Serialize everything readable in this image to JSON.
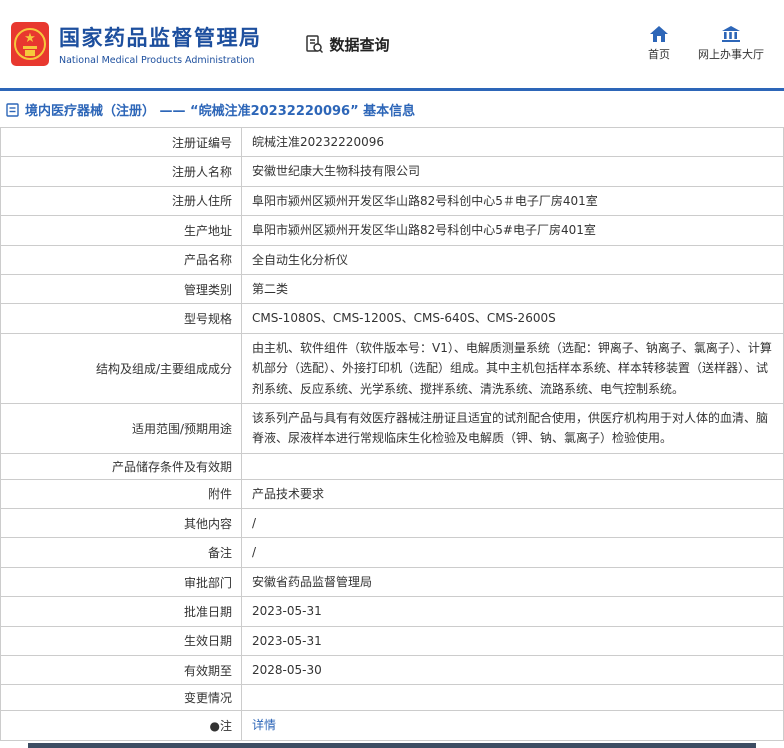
{
  "header": {
    "org_name_cn": "国家药品监督管理局",
    "org_name_en": "National Medical Products Administration",
    "data_query": "数据查询",
    "nav": [
      {
        "label": "首页",
        "icon": "home-icon"
      },
      {
        "label": "网上办事大厅",
        "icon": "building-icon"
      }
    ]
  },
  "page_title": "境内医疗器械（注册） —— “皖械注准20232220096” 基本信息",
  "colors": {
    "accent_blue": "#2d66b8",
    "brand_blue": "#1d4f9e",
    "emblem_red": "#e8382f",
    "emblem_gold": "#f6c83c",
    "table_border": "#cccccc"
  },
  "table": {
    "rows": [
      {
        "label": "注册证编号",
        "value": "皖械注准20232220096"
      },
      {
        "label": "注册人名称",
        "value": "安徽世纪康大生物科技有限公司"
      },
      {
        "label": "注册人住所",
        "value": "阜阳市颍州区颍州开发区华山路82号科创中心5＃电子厂房401室"
      },
      {
        "label": "生产地址",
        "value": "阜阳市颍州区颍州开发区华山路82号科创中心5#电子厂房401室"
      },
      {
        "label": "产品名称",
        "value": "全自动生化分析仪"
      },
      {
        "label": "管理类别",
        "value": "第二类"
      },
      {
        "label": "型号规格",
        "value": "CMS-1080S、CMS-1200S、CMS-640S、CMS-2600S"
      },
      {
        "label": "结构及组成/主要组成成分",
        "value": "由主机、软件组件（软件版本号：V1）、电解质测量系统（选配：钾离子、钠离子、氯离子）、计算机部分（选配）、外接打印机（选配）组成。其中主机包括样本系统、样本转移装置（送样器）、试剂系统、反应系统、光学系统、搅拌系统、清洗系统、流路系统、电气控制系统。"
      },
      {
        "label": "适用范围/预期用途",
        "value": "该系列产品与具有有效医疗器械注册证且适宜的试剂配合使用，供医疗机构用于对人体的血清、脑脊液、尿液样本进行常规临床生化检验及电解质（钾、钠、氯离子）检验使用。"
      },
      {
        "label": "产品储存条件及有效期",
        "value": ""
      },
      {
        "label": "附件",
        "value": "产品技术要求"
      },
      {
        "label": "其他内容",
        "value": "/"
      },
      {
        "label": "备注",
        "value": "/"
      },
      {
        "label": "审批部门",
        "value": "安徽省药品监督管理局"
      },
      {
        "label": "批准日期",
        "value": "2023-05-31"
      },
      {
        "label": "生效日期",
        "value": "2023-05-31"
      },
      {
        "label": "有效期至",
        "value": "2028-05-30"
      },
      {
        "label": "变更情况",
        "value": ""
      },
      {
        "label": "●注",
        "value": "详情"
      }
    ]
  }
}
